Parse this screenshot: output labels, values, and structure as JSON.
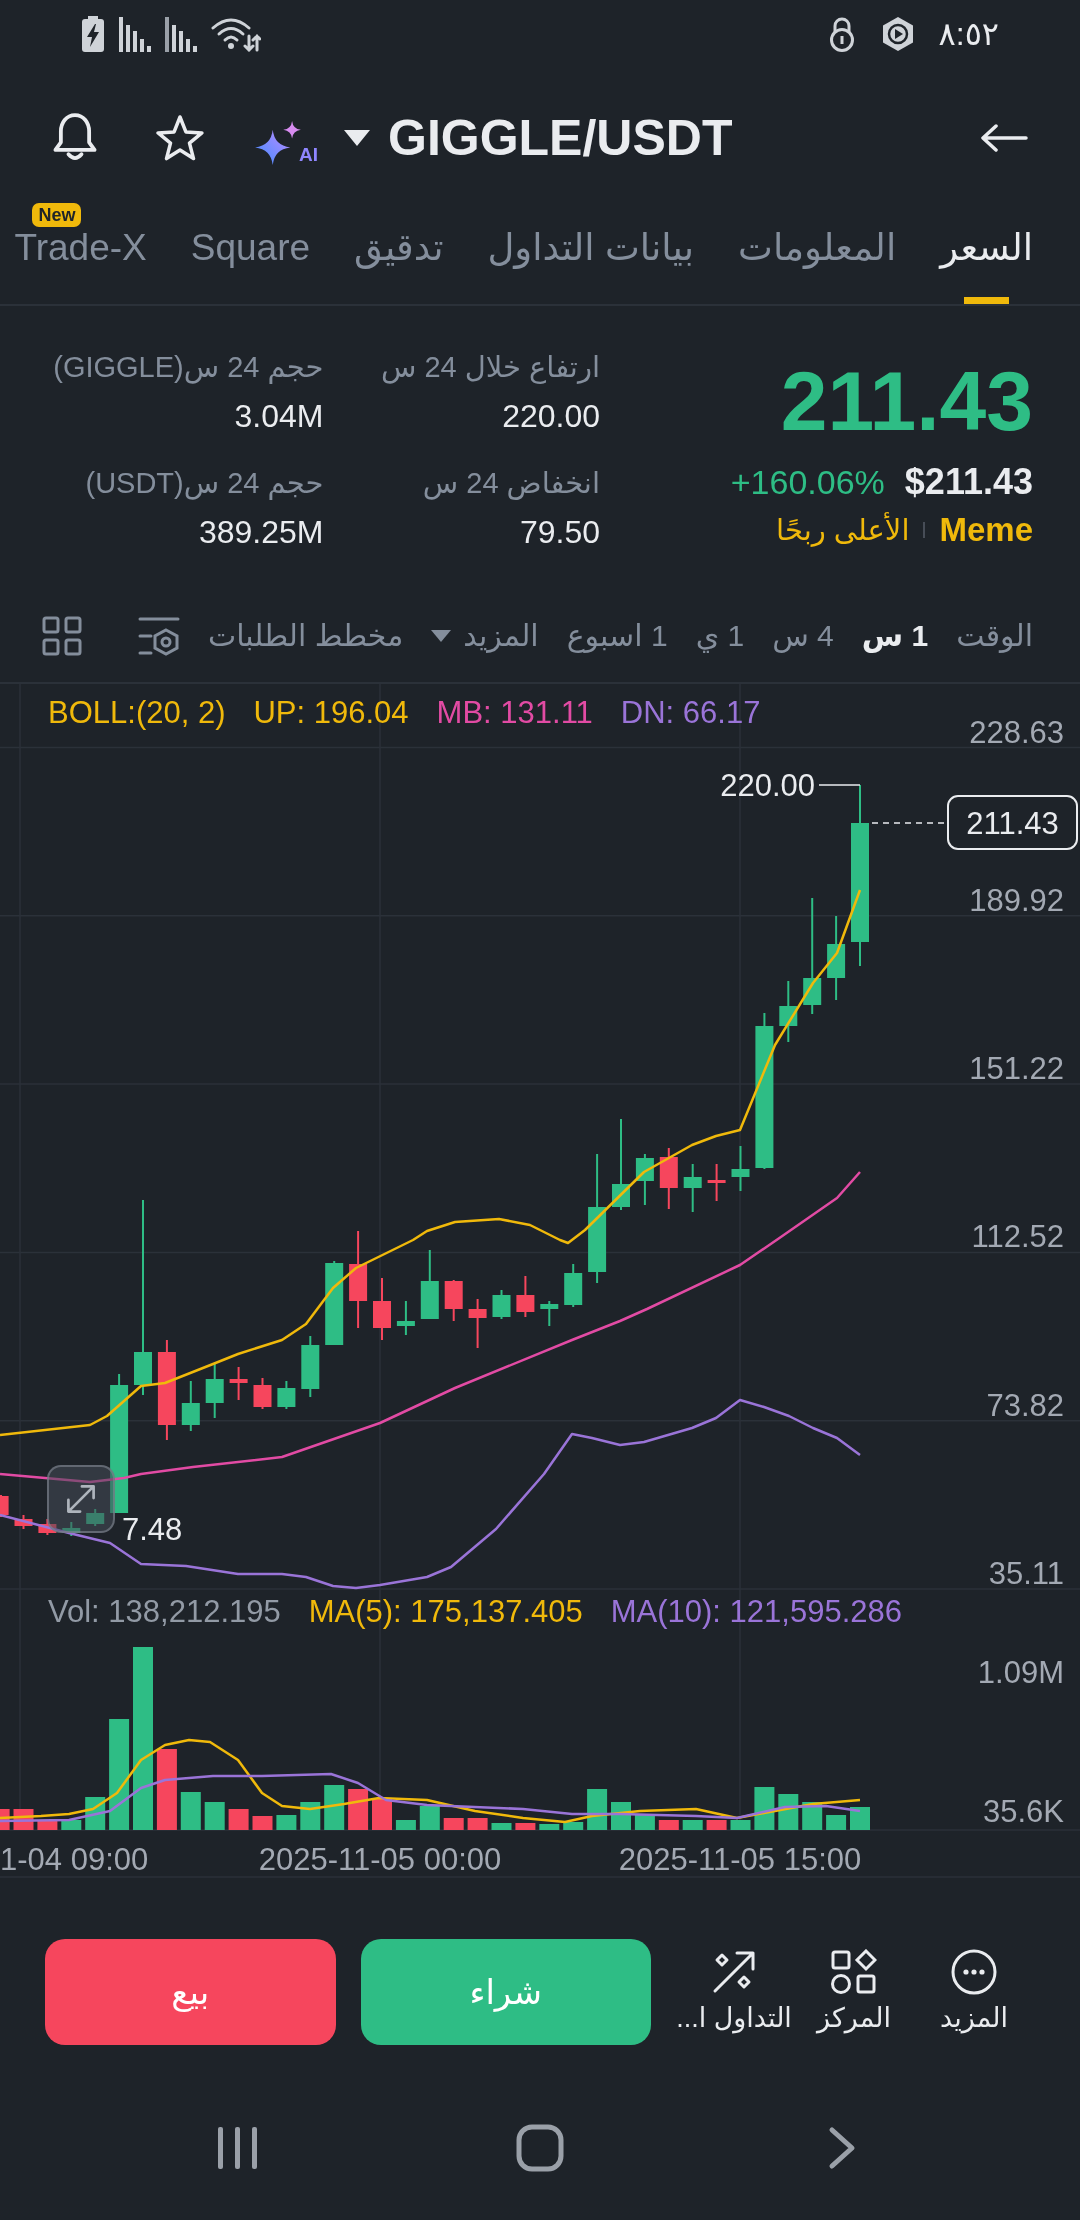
{
  "status_bar": {
    "time": "٨:٥٢"
  },
  "header": {
    "pair": "GIGGLE/USDT",
    "ai_label": "AI"
  },
  "tabs": [
    {
      "label": "السعر",
      "selected": true
    },
    {
      "label": "المعلومات",
      "selected": false
    },
    {
      "label": "بيانات التداول",
      "selected": false
    },
    {
      "label": "تدقيق",
      "selected": false
    },
    {
      "label": "Square",
      "selected": false
    },
    {
      "label": "Trade-X",
      "selected": false,
      "badge": "New"
    }
  ],
  "price": {
    "last": "211.43",
    "rising": true,
    "usd": "$211.43",
    "change": "+160.06%",
    "tags": [
      "Meme",
      "الأعلى ربحًا"
    ]
  },
  "stats": [
    {
      "label": "ارتفاع خلال 24 س",
      "value": "220.00"
    },
    {
      "label": "حجم 24 س(GIGGLE)",
      "value": "3.04M"
    },
    {
      "label": "انخفاض 24 س",
      "value": "79.50"
    },
    {
      "label": "حجم 24 س(USDT)",
      "value": "389.25M"
    }
  ],
  "toolbar": {
    "label": "الوقت",
    "intervals": [
      {
        "label": "1 س",
        "selected": true
      },
      {
        "label": "4 س",
        "selected": false
      },
      {
        "label": "1 ي",
        "selected": false
      },
      {
        "label": "1 اسبوع",
        "selected": false
      }
    ],
    "more": "المزيد",
    "depth_chart": "مخطط الطلبات"
  },
  "chart": {
    "boll_legend": [
      {
        "text": "DN: 66.17",
        "color": "#9a74d8"
      },
      {
        "text": "MB: 131.11",
        "color": "#e24ba4"
      },
      {
        "text": "UP: 196.04",
        "color": "#f0b90b"
      },
      {
        "text": "BOLL:(20, 2)",
        "color": "#f0b90b"
      }
    ],
    "price_ticks": [
      "228.63",
      "189.92",
      "151.22",
      "112.52",
      "73.82",
      "35.11"
    ],
    "high_label": "220.00",
    "low_label": "7.48",
    "last_price_tag": "211.43",
    "volume_legend": [
      {
        "text": "MA(10): 121,595.286",
        "color": "#9a74d8"
      },
      {
        "text": "MA(5): 175,137.405",
        "color": "#f0b90b"
      },
      {
        "text": "Vol: 138,212.195",
        "color": "#929aa5"
      }
    ],
    "volume_ticks": [
      "1.09M",
      "35.6K"
    ],
    "time_labels": [
      "2025-11-05 15:00",
      "2025-11-05 00:00",
      "1-04 09:00"
    ]
  },
  "actions": [
    "المزيد",
    "المركز",
    "التداول ا..."
  ],
  "trade_buttons": {
    "buy": "شراء",
    "sell": "بيع"
  }
}
